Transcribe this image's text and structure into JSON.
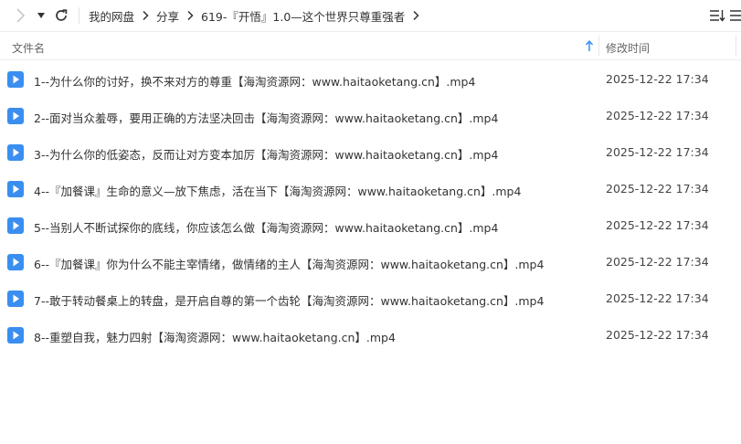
{
  "toolbar": {
    "forward_icon": "chevron-right-icon",
    "dropdown_icon": "caret-down-icon",
    "refresh_icon": "refresh-icon",
    "sort_icon": "sort-list-icon",
    "more_icon": "more-icon"
  },
  "breadcrumb": [
    "我的网盘",
    "分享",
    "619-『开悟』1.0—这个世界只尊重强者"
  ],
  "header": {
    "name_label": "文件名",
    "time_label": "修改时间",
    "sort_direction": "ascending"
  },
  "files": [
    {
      "name": "1--为什么你的讨好，换不来对方的尊重【海淘资源网：www.haitaoketang.cn】.mp4",
      "time": "2025-12-22 17:34",
      "icon": "video-file-icon"
    },
    {
      "name": "2--面对当众羞辱，要用正确的方法坚决回击【海淘资源网：www.haitaoketang.cn】.mp4",
      "time": "2025-12-22 17:34",
      "icon": "video-file-icon"
    },
    {
      "name": "3--为什么你的低姿态，反而让对方变本加厉【海淘资源网：www.haitaoketang.cn】.mp4",
      "time": "2025-12-22 17:34",
      "icon": "video-file-icon"
    },
    {
      "name": "4--『加餐课』生命的意义—放下焦虑，活在当下【海淘资源网：www.haitaoketang.cn】.mp4",
      "time": "2025-12-22 17:34",
      "icon": "video-file-icon"
    },
    {
      "name": "5--当别人不断试探你的底线，你应该怎么做【海淘资源网：www.haitaoketang.cn】.mp4",
      "time": "2025-12-22 17:34",
      "icon": "video-file-icon"
    },
    {
      "name": "6--『加餐课』你为什么不能主宰情绪，做情绪的主人【海淘资源网：www.haitaoketang.cn】.mp4",
      "time": "2025-12-22 17:34",
      "icon": "video-file-icon"
    },
    {
      "name": "7--敢于转动餐桌上的转盘，是开启自尊的第一个齿轮【海淘资源网：www.haitaoketang.cn】.mp4",
      "time": "2025-12-22 17:34",
      "icon": "video-file-icon"
    },
    {
      "name": "8--重塑自我，魅力四射【海淘资源网：www.haitaoketang.cn】.mp4",
      "time": "2025-12-22 17:34",
      "icon": "video-file-icon"
    }
  ],
  "colors": {
    "accent": "#2b8ff5",
    "icon_blue": "#3a8ef0",
    "text": "#333333",
    "muted": "#666666"
  }
}
